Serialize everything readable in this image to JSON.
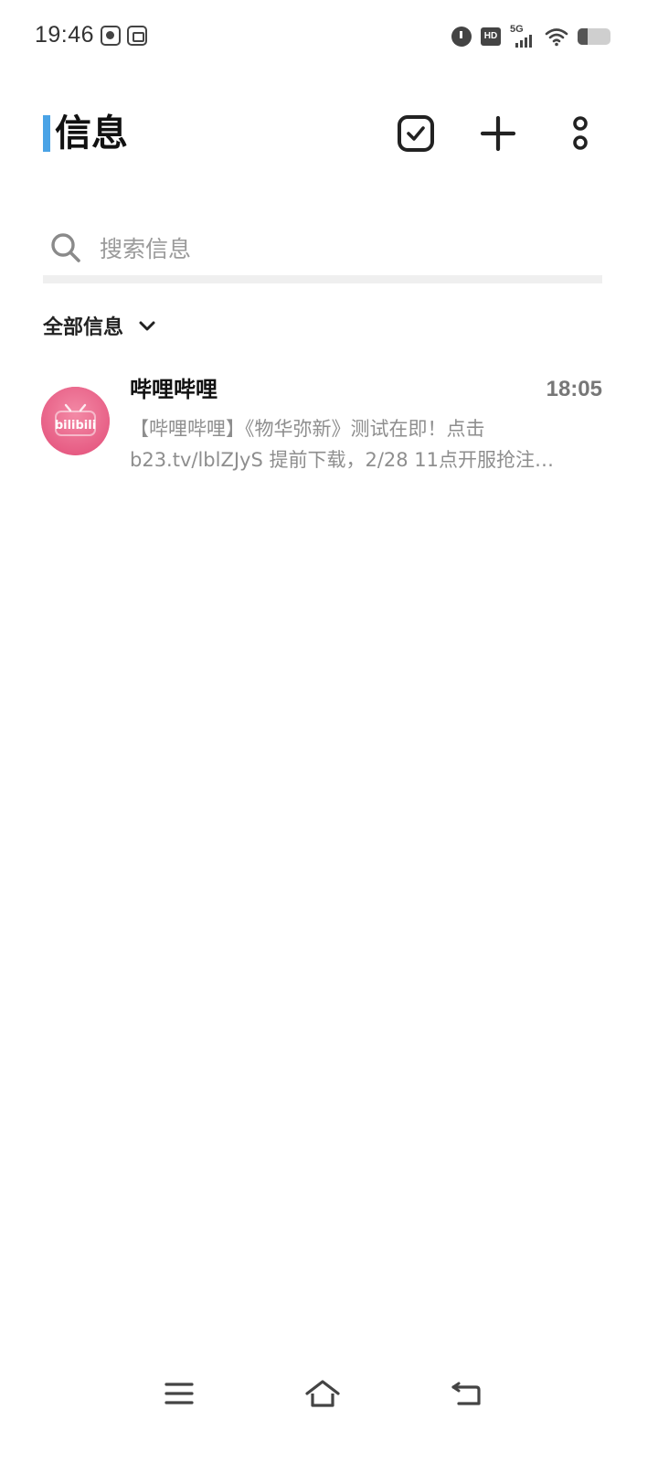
{
  "status_bar": {
    "time": "19:46",
    "network_label": "5G",
    "hd_label": "HD",
    "battery_level": 0.3,
    "left_icons": [
      "video-call-icon",
      "screen-record-icon"
    ],
    "right_icons": [
      "alarm-icon",
      "hd-icon",
      "signal-5g-icon",
      "wifi-icon",
      "battery-icon"
    ]
  },
  "header": {
    "title": "信息",
    "accent_color": "#4aa3e6",
    "actions": [
      "select-check-icon",
      "plus-icon",
      "more-vertical-icon"
    ]
  },
  "search": {
    "placeholder": "搜索信息",
    "value": ""
  },
  "filter": {
    "label": "全部信息"
  },
  "messages": [
    {
      "sender": "哔哩哔哩",
      "time": "18:05",
      "avatar_text": "bilibili",
      "avatar_color": "#ec6d8f",
      "preview_line1": "【哔哩哔哩】《物华弥新》测试在即！点击",
      "preview_line2": "b23.tv/lblZJyS 提前下载，2/28 11点开服抢注…"
    }
  ],
  "navbar": {
    "icons": [
      "menu-icon",
      "home-icon",
      "back-icon"
    ]
  }
}
